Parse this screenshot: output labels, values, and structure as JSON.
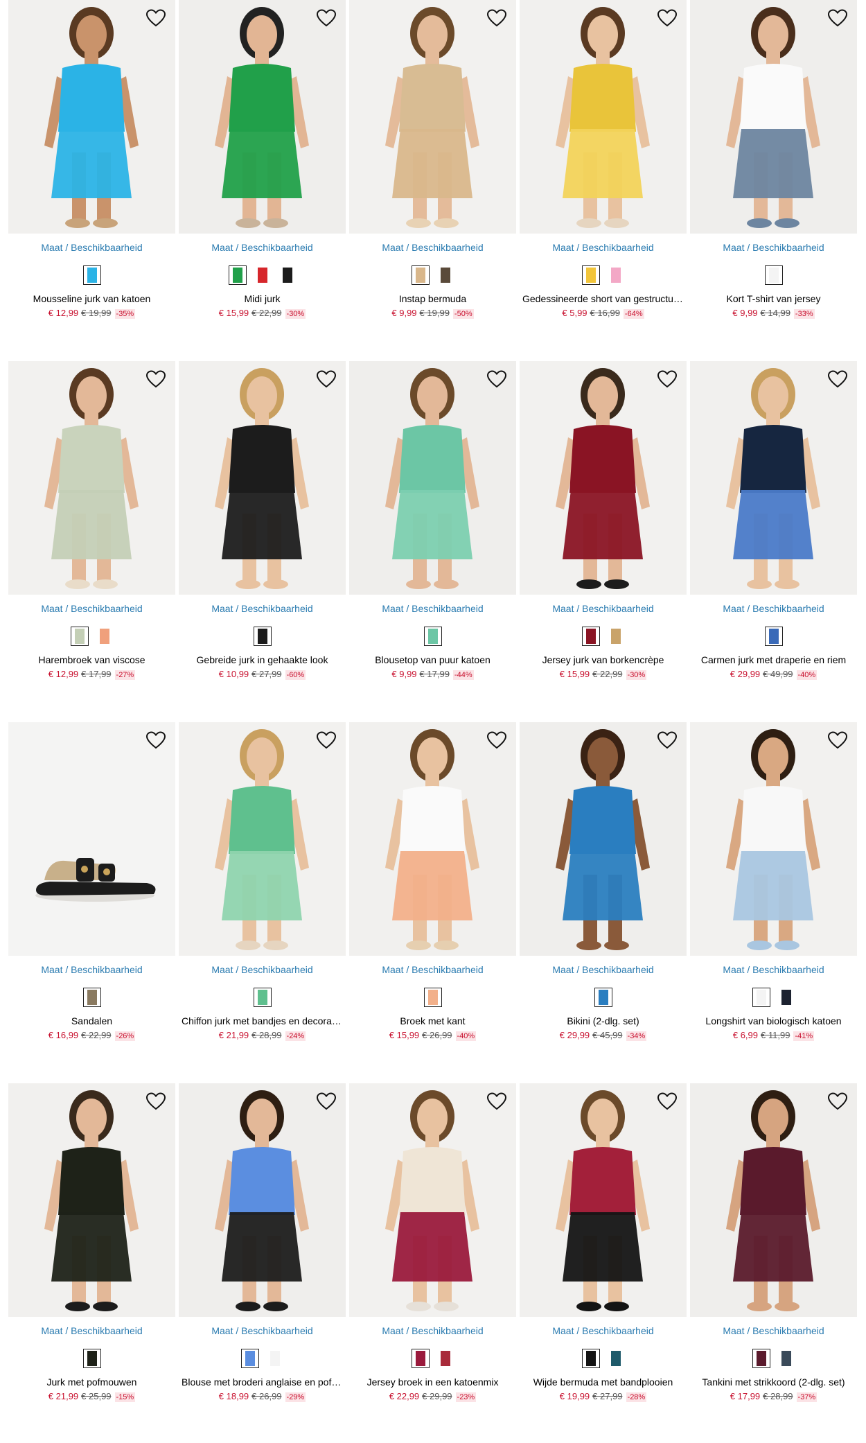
{
  "avail_label": "Maat / Beschikbaarheid",
  "products": [
    {
      "name": "Mousseline jurk van katoen",
      "price": "€ 12,99",
      "old": "€ 19,99",
      "disc": "-35%",
      "skin": "#c9936b",
      "hair": "#5a3a22",
      "top": "#2bb3e6",
      "bottom": "#2bb3e6",
      "shoes": "#c8a37a",
      "swatches": [
        "#2bb3e6"
      ]
    },
    {
      "name": "Midi jurk",
      "price": "€ 15,99",
      "old": "€ 22,99",
      "disc": "-30%",
      "skin": "#e2b594",
      "hair": "#222222",
      "top": "#21a04a",
      "bottom": "#21a04a",
      "shoes": "#c9b39a",
      "swatches": [
        "#21a04a",
        "#d6262b",
        "#1c1c1c"
      ]
    },
    {
      "name": "Instap bermuda",
      "price": "€ 9,99",
      "old": "€ 19,99",
      "disc": "-50%",
      "skin": "#e4bb9a",
      "hair": "#6b4a2a",
      "top": "#d8bc93",
      "bottom": "#d9b78b",
      "shoes": "#e8d2b4",
      "swatches": [
        "#d9b78b",
        "#5a4a3a"
      ]
    },
    {
      "name": "Gedessineerde short van gestructureerd",
      "price": "€ 5,99",
      "old": "€ 16,99",
      "disc": "-64%",
      "skin": "#e8c2a0",
      "hair": "#5a3a22",
      "top": "#e9c43a",
      "bottom": "#f2d35a",
      "shoes": "#e6d5c0",
      "swatches": [
        "#f2c53a",
        "#f3a8c6"
      ]
    },
    {
      "name": "Kort T-shirt van jersey",
      "price": "€ 9,99",
      "old": "€ 14,99",
      "disc": "-33%",
      "skin": "#e3b898",
      "hair": "#4a2e1c",
      "top": "#fafafa",
      "bottom": "#6d85a0",
      "shoes": "#6d85a0",
      "swatches": [
        "#f4f4f4"
      ]
    },
    {
      "name": "Harembroek van viscose",
      "price": "€ 12,99",
      "old": "€ 17,99",
      "disc": "-27%",
      "skin": "#e3b898",
      "hair": "#5a3a22",
      "top": "#c9d3bc",
      "bottom": "#c4cfb6",
      "shoes": "#e9dcc9",
      "swatches": [
        "#c4cfb6",
        "#f0a07c"
      ]
    },
    {
      "name": "Gebreide jurk in gehaakte look",
      "price": "€ 10,99",
      "old": "€ 27,99",
      "disc": "-60%",
      "skin": "#e8c2a0",
      "hair": "#c9a060",
      "top": "#1c1c1c",
      "bottom": "#1c1c1c",
      "shoes": "#e8c2a0",
      "swatches": [
        "#1c1c1c"
      ]
    },
    {
      "name": "Blousetop van puur katoen",
      "price": "€ 9,99",
      "old": "€ 17,99",
      "disc": "-44%",
      "skin": "#e3b898",
      "hair": "#6b4a2a",
      "top": "#6cc6a5",
      "bottom": "#7ccfb0",
      "shoes": "#e3b898",
      "swatches": [
        "#6cc6a5"
      ]
    },
    {
      "name": "Jersey jurk van borkencrèpe",
      "price": "€ 15,99",
      "old": "€ 22,99",
      "disc": "-30%",
      "skin": "#e3b898",
      "hair": "#3a2a1c",
      "top": "#8a1424",
      "bottom": "#8a1424",
      "shoes": "#1c1c1c",
      "swatches": [
        "#8a1424",
        "#c9a36a"
      ]
    },
    {
      "name": "Carmen jurk met draperie en riem",
      "price": "€ 29,99",
      "old": "€ 49,99",
      "disc": "-40%",
      "skin": "#e8c2a0",
      "hair": "#c9a060",
      "top": "#162640",
      "bottom": "#4a7ac8",
      "shoes": "#e8c2a0",
      "swatches": [
        "#3a6ab8"
      ]
    },
    {
      "name": "Sandalen",
      "price": "€ 16,99",
      "old": "€ 22,99",
      "disc": "-26%",
      "skin": "",
      "hair": "",
      "top": "",
      "bottom": "",
      "shoes": "#c8b08a",
      "swatches": [
        "#8a7a60"
      ]
    },
    {
      "name": "Chiffon jurk met bandjes en decoratieve",
      "price": "€ 21,99",
      "old": "€ 28,99",
      "disc": "-24%",
      "skin": "#e8c2a0",
      "hair": "#c9a060",
      "top": "#5fc08e",
      "bottom": "#8fd4ae",
      "shoes": "#e6d5c0",
      "swatches": [
        "#5fc08e"
      ]
    },
    {
      "name": "Broek met kant",
      "price": "€ 15,99",
      "old": "€ 26,99",
      "disc": "-40%",
      "skin": "#e8c2a0",
      "hair": "#6b4a2a",
      "top": "#fafafa",
      "bottom": "#f2b08a",
      "shoes": "#e6cfb0",
      "swatches": [
        "#f2b08a"
      ]
    },
    {
      "name": "Bikini (2-dlg. set)",
      "price": "€ 29,99",
      "old": "€ 45,99",
      "disc": "-34%",
      "skin": "#8a5a3a",
      "hair": "#3a2214",
      "top": "#2a7ec0",
      "bottom": "#2a7ec0",
      "shoes": "#8a5a3a",
      "swatches": [
        "#2a7ec0"
      ]
    },
    {
      "name": "Longshirt van biologisch katoen",
      "price": "€ 6,99",
      "old": "€ 11,99",
      "disc": "-41%",
      "skin": "#d9a882",
      "hair": "#2e1e12",
      "top": "#f8f8f8",
      "bottom": "#a9c6e0",
      "shoes": "#a9c6e0",
      "swatches": [
        "#f4f4f4",
        "#1c2230"
      ]
    },
    {
      "name": "Jurk met pofmouwen",
      "price": "€ 21,99",
      "old": "€ 25,99",
      "disc": "-15%",
      "skin": "#e3b898",
      "hair": "#3a2a1c",
      "top": "#1e2218",
      "bottom": "#1e2218",
      "shoes": "#1c1c1c",
      "swatches": [
        "#1e2218"
      ]
    },
    {
      "name": "Blouse met broderi anglaise en pofmouwen",
      "price": "€ 18,99",
      "old": "€ 26,99",
      "disc": "-29%",
      "skin": "#e3b898",
      "hair": "#2e1e12",
      "top": "#5b8ee0",
      "bottom": "#1c1c1c",
      "shoes": "#1c1c1c",
      "swatches": [
        "#5b8ee0",
        "#f4f4f4"
      ]
    },
    {
      "name": "Jersey broek in een katoenmix",
      "price": "€ 22,99",
      "old": "€ 29,99",
      "disc": "-23%",
      "skin": "#e8c2a0",
      "hair": "#6b4a2a",
      "top": "#efe5d6",
      "bottom": "#9a1a3c",
      "shoes": "#e6e0d8",
      "swatches": [
        "#9a1a3c",
        "#a82a3a"
      ]
    },
    {
      "name": "Wijde bermuda met bandplooien",
      "price": "€ 19,99",
      "old": "€ 27,99",
      "disc": "-28%",
      "skin": "#e8c2a0",
      "hair": "#6b4a2a",
      "top": "#a3203a",
      "bottom": "#141414",
      "shoes": "#141414",
      "swatches": [
        "#141414",
        "#1e5a6a"
      ]
    },
    {
      "name": "Tankini met strikkoord (2-dlg. set)",
      "price": "€ 17,99",
      "old": "€ 28,99",
      "disc": "-37%",
      "skin": "#d6a480",
      "hair": "#2e1e12",
      "top": "#5a1a2c",
      "bottom": "#5a1a2c",
      "shoes": "#d6a480",
      "swatches": [
        "#5a1a2c",
        "#3a4a5a"
      ]
    }
  ]
}
